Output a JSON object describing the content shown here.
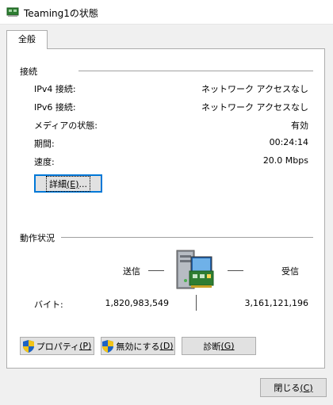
{
  "window": {
    "title": "Teaming1の状態"
  },
  "tabs": [
    {
      "label": "全般",
      "selected": true
    }
  ],
  "connection": {
    "group_title": "接続",
    "rows": [
      {
        "label": "IPv4 接続:",
        "value": "ネットワーク アクセスなし"
      },
      {
        "label": "IPv6 接続:",
        "value": "ネットワーク アクセスなし"
      },
      {
        "label": "メディアの状態:",
        "value": "有効"
      },
      {
        "label": "期間:",
        "value": "00:24:14"
      },
      {
        "label": "速度:",
        "value": "20.0 Mbps"
      }
    ],
    "details_button": {
      "label": "詳細",
      "accel": "(E)",
      "suffix": "..."
    }
  },
  "activity": {
    "group_title": "動作状況",
    "sent_label": "送信",
    "received_label": "受信",
    "bytes_label": "バイト:",
    "bytes_sent": "1,820,983,549",
    "bytes_received": "3,161,121,196",
    "icon": "network-computer-icon"
  },
  "buttons": {
    "properties": {
      "label": "プロパティ",
      "accel": "(P)",
      "icon": "uac-shield-icon"
    },
    "disable": {
      "label": "無効にする",
      "accel": "(D)",
      "icon": "uac-shield-icon"
    },
    "diagnose": {
      "label": "診断",
      "accel": "(G)"
    },
    "close": {
      "label": "閉じる",
      "accel": "(C)"
    }
  },
  "colors": {
    "focus": "#0078d7",
    "button_face": "#e1e1e1",
    "background": "#f0f0f0"
  }
}
